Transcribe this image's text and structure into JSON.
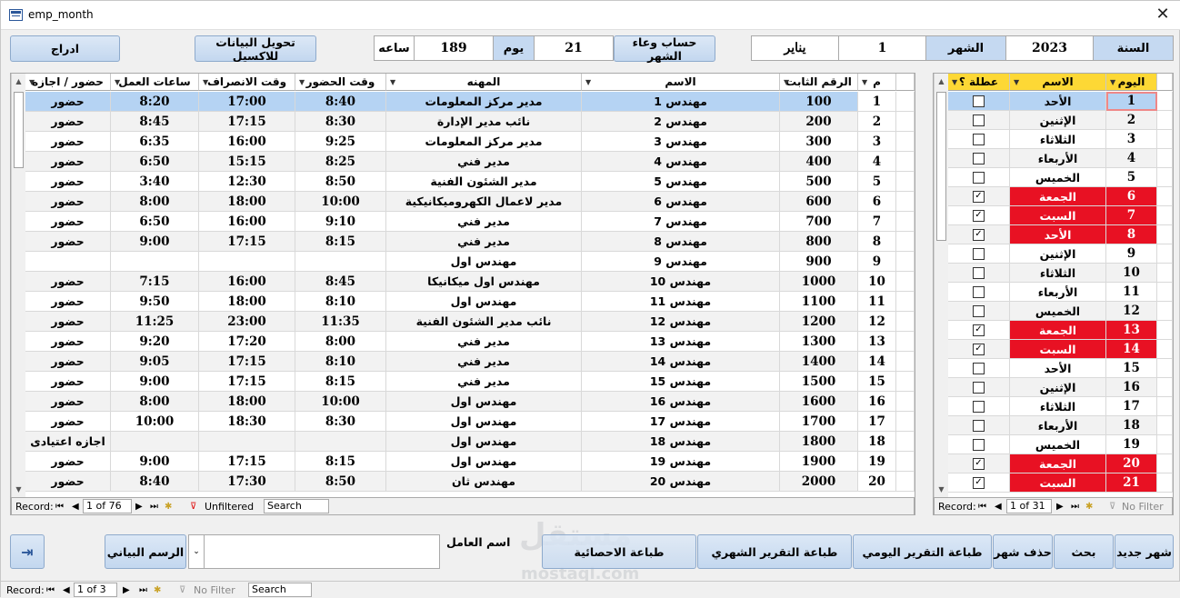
{
  "window": {
    "title": "emp_month"
  },
  "top": {
    "year_label": "السنة",
    "year_value": "2023",
    "month_label": "الشهر",
    "month_number": "1",
    "month_name": "يناير",
    "calc_button": "حساب وعاء الشهر",
    "day_value": "21",
    "day_label": "يوم",
    "hours_value": "189",
    "hours_label": "ساعه",
    "export_button": "تحويل البيانات للاكسيل",
    "insert_button": "ادراج"
  },
  "emp_grid": {
    "headers": [
      "م",
      "الرقم الثابت",
      "الاسم",
      "المهنه",
      "وقت الحضور",
      "وقت الانصراف",
      "ساعات العمل",
      "حضور / اجازه"
    ],
    "rows": [
      [
        "1",
        "100",
        "مهندس 1",
        "مدير مركز المعلومات",
        "8:40",
        "17:00",
        "8:20",
        "حضور"
      ],
      [
        "2",
        "200",
        "مهندس 2",
        "نائب مدير الإدارة",
        "8:30",
        "17:15",
        "8:45",
        "حضور"
      ],
      [
        "3",
        "300",
        "مهندس 3",
        "مدير مركز المعلومات",
        "9:25",
        "16:00",
        "6:35",
        "حضور"
      ],
      [
        "4",
        "400",
        "مهندس 4",
        "مدير فني",
        "8:25",
        "15:15",
        "6:50",
        "حضور"
      ],
      [
        "5",
        "500",
        "مهندس 5",
        "مدير الشئون الفنية",
        "8:50",
        "12:30",
        "3:40",
        "حضور"
      ],
      [
        "6",
        "600",
        "مهندس 6",
        "مدير لاعمال الكهروميكانيكية",
        "10:00",
        "18:00",
        "8:00",
        "حضور"
      ],
      [
        "7",
        "700",
        "مهندس 7",
        "مدير فني",
        "9:10",
        "16:00",
        "6:50",
        "حضور"
      ],
      [
        "8",
        "800",
        "مهندس 8",
        "مدير فني",
        "8:15",
        "17:15",
        "9:00",
        "حضور"
      ],
      [
        "9",
        "900",
        "مهندس 9",
        "مهندس اول",
        "",
        "",
        "",
        ""
      ],
      [
        "10",
        "1000",
        "مهندس 10",
        "مهندس اول ميكانيكا",
        "8:45",
        "16:00",
        "7:15",
        "حضور"
      ],
      [
        "11",
        "1100",
        "مهندس 11",
        "مهندس اول",
        "8:10",
        "18:00",
        "9:50",
        "حضور"
      ],
      [
        "12",
        "1200",
        "مهندس 12",
        "نائب مدير الشئون الفنية",
        "11:35",
        "23:00",
        "11:25",
        "حضور"
      ],
      [
        "13",
        "1300",
        "مهندس 13",
        "مدير فني",
        "8:00",
        "17:20",
        "9:20",
        "حضور"
      ],
      [
        "14",
        "1400",
        "مهندس 14",
        "مدير فني",
        "8:10",
        "17:15",
        "9:05",
        "حضور"
      ],
      [
        "15",
        "1500",
        "مهندس 15",
        "مدير فني",
        "8:15",
        "17:15",
        "9:00",
        "حضور"
      ],
      [
        "16",
        "1600",
        "مهندس 16",
        "مهندس اول",
        "10:00",
        "18:00",
        "8:00",
        "حضور"
      ],
      [
        "17",
        "1700",
        "مهندس 17",
        "مهندس اول",
        "8:30",
        "18:30",
        "10:00",
        "حضور"
      ],
      [
        "18",
        "1800",
        "مهندس 18",
        "مهندس اول",
        "",
        "",
        "",
        "اجازه اعتيادى"
      ],
      [
        "19",
        "1900",
        "مهندس 19",
        "مهندس اول",
        "8:15",
        "17:15",
        "9:00",
        "حضور"
      ],
      [
        "20",
        "2000",
        "مهندس 20",
        "مهندس ثان",
        "8:50",
        "17:30",
        "8:40",
        "حضور"
      ]
    ],
    "nav": {
      "label": "Record:",
      "position": "1 of 76",
      "filter": "Unfiltered",
      "search": "Search"
    }
  },
  "day_grid": {
    "headers": [
      "اليوم",
      "الاسم",
      "عطلة ؟"
    ],
    "rows": [
      {
        "day": "1",
        "name": "الأحد",
        "off": false,
        "red": false
      },
      {
        "day": "2",
        "name": "الإثنين",
        "off": false,
        "red": false
      },
      {
        "day": "3",
        "name": "الثلاثاء",
        "off": false,
        "red": false
      },
      {
        "day": "4",
        "name": "الأربعاء",
        "off": false,
        "red": false
      },
      {
        "day": "5",
        "name": "الخميس",
        "off": false,
        "red": false
      },
      {
        "day": "6",
        "name": "الجمعة",
        "off": true,
        "red": true
      },
      {
        "day": "7",
        "name": "السبت",
        "off": true,
        "red": true
      },
      {
        "day": "8",
        "name": "الأحد",
        "off": true,
        "red": true
      },
      {
        "day": "9",
        "name": "الإثنين",
        "off": false,
        "red": false
      },
      {
        "day": "10",
        "name": "الثلاثاء",
        "off": false,
        "red": false
      },
      {
        "day": "11",
        "name": "الأربعاء",
        "off": false,
        "red": false
      },
      {
        "day": "12",
        "name": "الخميس",
        "off": false,
        "red": false
      },
      {
        "day": "13",
        "name": "الجمعة",
        "off": true,
        "red": true
      },
      {
        "day": "14",
        "name": "السبت",
        "off": true,
        "red": true
      },
      {
        "day": "15",
        "name": "الأحد",
        "off": false,
        "red": false
      },
      {
        "day": "16",
        "name": "الإثنين",
        "off": false,
        "red": false
      },
      {
        "day": "17",
        "name": "الثلاثاء",
        "off": false,
        "red": false
      },
      {
        "day": "18",
        "name": "الأربعاء",
        "off": false,
        "red": false
      },
      {
        "day": "19",
        "name": "الخميس",
        "off": false,
        "red": false
      },
      {
        "day": "20",
        "name": "الجمعة",
        "off": true,
        "red": true
      },
      {
        "day": "21",
        "name": "السبت",
        "off": true,
        "red": true
      }
    ],
    "nav": {
      "label": "Record:",
      "position": "1 of 31",
      "filter": "No Filter",
      "search": "Search"
    }
  },
  "bottom": {
    "new_month": "شهر جديد",
    "search": "بحث",
    "delete_month": "حذف شهر",
    "daily_report": "طباعة التقرير اليومي",
    "monthly_report": "طباعة التقرير الشهري",
    "stats": "طباعة الاحصائية",
    "worker_label": "اسم العامل",
    "worker_value": "",
    "chart_button": "الرسم البياني",
    "watermark": "مستقل",
    "watermark_url": "mostaql.com"
  },
  "form_nav": {
    "label": "Record:",
    "position": "1 of 3",
    "filter": "No Filter",
    "search": "Search"
  },
  "colors": {
    "header_blue": "#c5d9f1",
    "selected_row": "#b5d3f3",
    "holiday_red": "#e81123",
    "day_header": "#fdd835"
  }
}
